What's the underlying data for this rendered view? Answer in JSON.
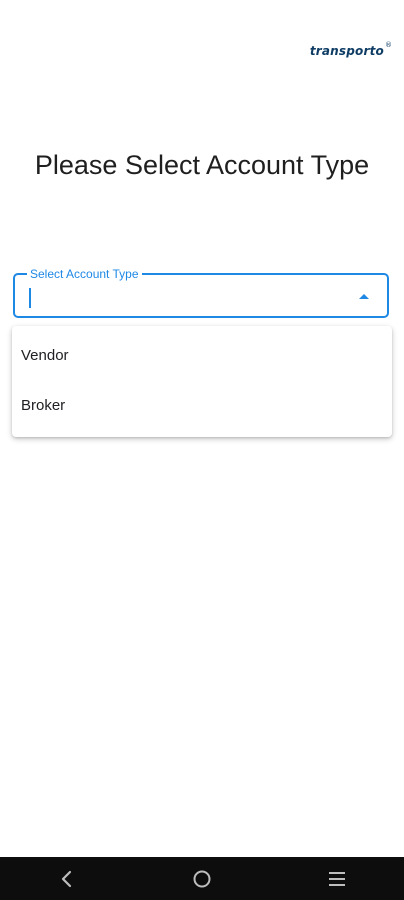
{
  "brand": {
    "logo_text": "transporto",
    "registered_mark": "®"
  },
  "page": {
    "title": "Please Select Account Type"
  },
  "account_type_field": {
    "label": "Select Account Type",
    "value": "",
    "expanded": true
  },
  "dropdown": {
    "options": [
      {
        "label": "Vendor"
      },
      {
        "label": "Broker"
      }
    ]
  },
  "system_nav": {
    "icons": [
      "back-icon",
      "home-icon",
      "recents-icon"
    ]
  },
  "colors": {
    "accent": "#1e88e5",
    "brand": "#0e3c64",
    "nav_background": "#0d0d0d"
  }
}
